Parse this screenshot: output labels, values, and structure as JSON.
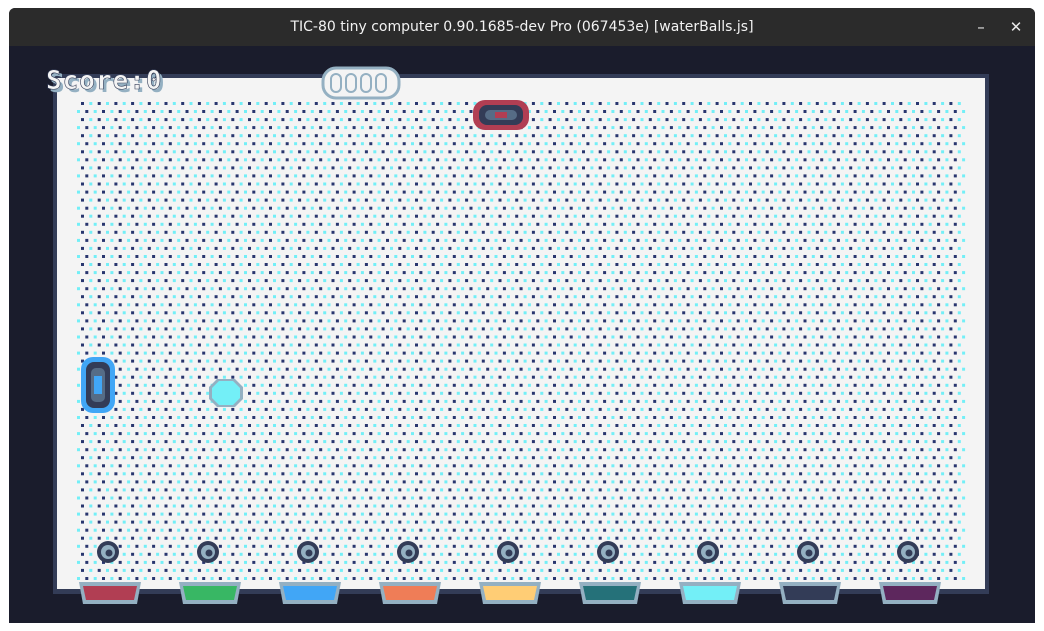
{
  "window": {
    "title": "TIC-80 tiny computer 0.90.1685-dev Pro (067453e) [waterBalls.js]",
    "minimize_glyph": "–",
    "close_glyph": "✕"
  },
  "game": {
    "score_label": "Score:0",
    "palette": {
      "background": "#1a1c2c",
      "board": "#f4f4f4",
      "board_border": "#333c57",
      "dot_dark": "#29366f",
      "dot_light": "#73eff7",
      "ball": "#73eff7",
      "ball_outline": "#94b0c2"
    },
    "buckets": [
      {
        "color": "#b13e53",
        "name": "red"
      },
      {
        "color": "#38b764",
        "name": "green"
      },
      {
        "color": "#41a6f6",
        "name": "blue"
      },
      {
        "color": "#ef7d57",
        "name": "orange"
      },
      {
        "color": "#ffcd75",
        "name": "yellow"
      },
      {
        "color": "#257179",
        "name": "teal"
      },
      {
        "color": "#73eff7",
        "name": "cyan"
      },
      {
        "color": "#333c57",
        "name": "navy"
      },
      {
        "color": "#5d275d",
        "name": "purple"
      }
    ],
    "icons": {
      "red_portal": "horizontal-portal-icon",
      "blue_portal": "vertical-portal-icon",
      "peg": "peg-icon",
      "lives": "lives-capsule-icon"
    }
  }
}
